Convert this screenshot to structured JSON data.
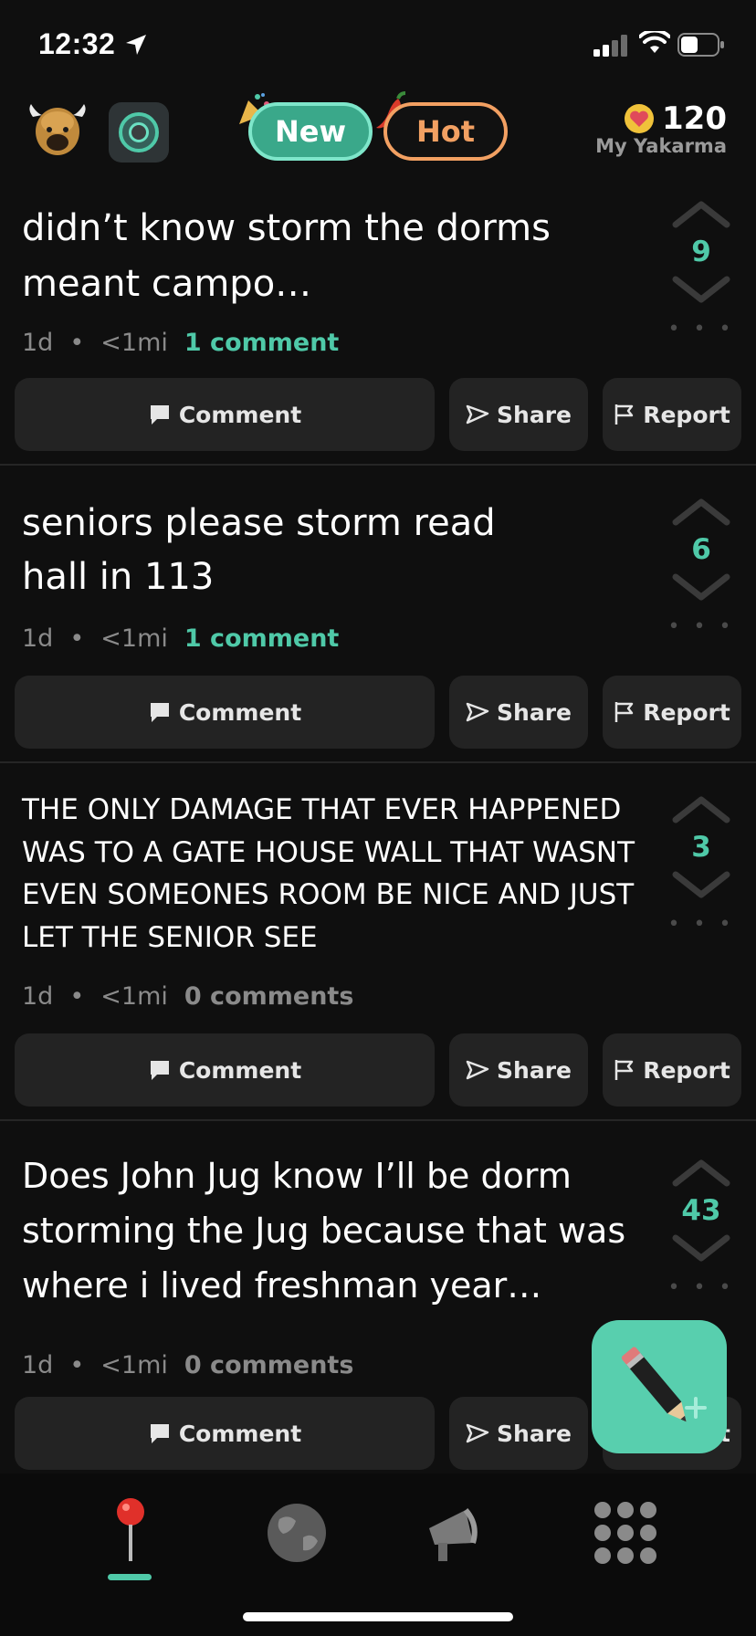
{
  "status_bar": {
    "time": "12:32"
  },
  "header": {
    "tab_new": "New",
    "tab_hot": "Hot",
    "karma_value": "120",
    "karma_label": "My Yakarma"
  },
  "posts": [
    {
      "text": "didn’t know storm the dorms meant campo…",
      "age": "1d",
      "distance": "<1mi",
      "comments": "1 comment",
      "votes": "9"
    },
    {
      "text": "seniors please storm read hall in 113",
      "age": "1d",
      "distance": "<1mi",
      "comments": "1 comment",
      "votes": "6"
    },
    {
      "text": "THE ONLY DAMAGE THAT EVER HAPPENED WAS TO A GATE HOUSE WALL THAT WASNT EVEN SOMEONES ROOM BE NICE AND JUST LET THE SENIOR SEE",
      "age": "1d",
      "distance": "<1mi",
      "comments": "0 comments",
      "votes": "3"
    },
    {
      "text": "Does John Jug know I’ll be dorm storming the Jug because that was where i lived freshman year…",
      "age": "1d",
      "distance": "<1mi",
      "comments": "0 comments",
      "votes": "43"
    }
  ],
  "actions": {
    "comment": "Comment",
    "share": "Share",
    "report": "Report"
  },
  "meta_separator": "•",
  "more": "• • •",
  "colors": {
    "accent": "#4fc9a8",
    "hot": "#f2a062",
    "background": "#0f0f0f",
    "button": "#232323"
  },
  "icons": {
    "nav": [
      "map-pin-icon",
      "globe-icon",
      "megaphone-icon",
      "grid-icon"
    ],
    "fab": "pencil-plus-icon"
  }
}
